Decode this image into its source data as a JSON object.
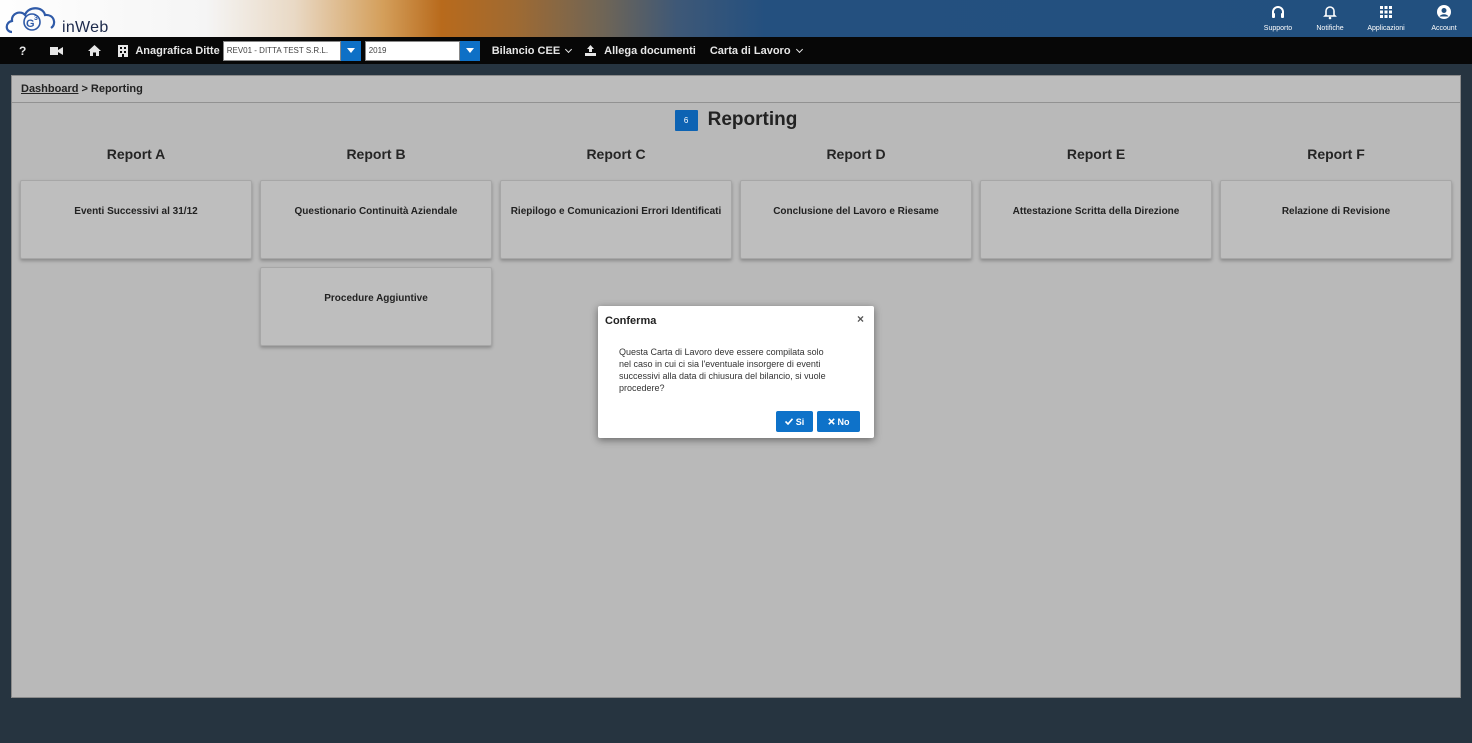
{
  "header": {
    "logo_text": "inWeb",
    "actions": [
      {
        "label": "Supporto",
        "icon": "headset-icon"
      },
      {
        "label": "Notifiche",
        "icon": "bell-icon"
      },
      {
        "label": "Applicazioni",
        "icon": "apps-grid-icon"
      },
      {
        "label": "Account",
        "icon": "account-circle-icon"
      }
    ]
  },
  "toolbar": {
    "help_icon": "?",
    "anagrafica_label": "Anagrafica Ditte",
    "company_value": "REV01 - DITTA TEST S.R.L.",
    "year_value": "2019",
    "bilancio_label": "Bilancio CEE",
    "allega_label": "Allega documenti",
    "carta_label": "Carta di Lavoro"
  },
  "breadcrumb": {
    "root": "Dashboard",
    "separator": ">",
    "current": "Reporting"
  },
  "page": {
    "badge": "6",
    "title": "Reporting"
  },
  "columns": [
    {
      "head": "Report A",
      "cards": [
        "Eventi Successivi al 31/12"
      ]
    },
    {
      "head": "Report B",
      "cards": [
        "Questionario Continuità Aziendale",
        "Procedure Aggiuntive"
      ]
    },
    {
      "head": "Report C",
      "cards": [
        "Riepilogo e Comunicazioni Errori Identificati"
      ]
    },
    {
      "head": "Report D",
      "cards": [
        "Conclusione del Lavoro e Riesame"
      ]
    },
    {
      "head": "Report E",
      "cards": [
        "Attestazione Scritta della Direzione"
      ]
    },
    {
      "head": "Report F",
      "cards": [
        "Relazione di Revisione"
      ]
    }
  ],
  "dialog": {
    "title": "Conferma",
    "close": "×",
    "message_lines": [
      "Questa Carta di Lavoro deve essere compilata solo",
      "nel caso in cui ci sia l'eventuale insorgere di eventi",
      "successivi alla data di chiusura del bilancio, si vuole",
      "procedere?"
    ],
    "yes_label": "Si",
    "no_label": "No"
  },
  "colors": {
    "accent": "#0e72c9",
    "panel": "#b9b9b9",
    "background": "#263440"
  }
}
